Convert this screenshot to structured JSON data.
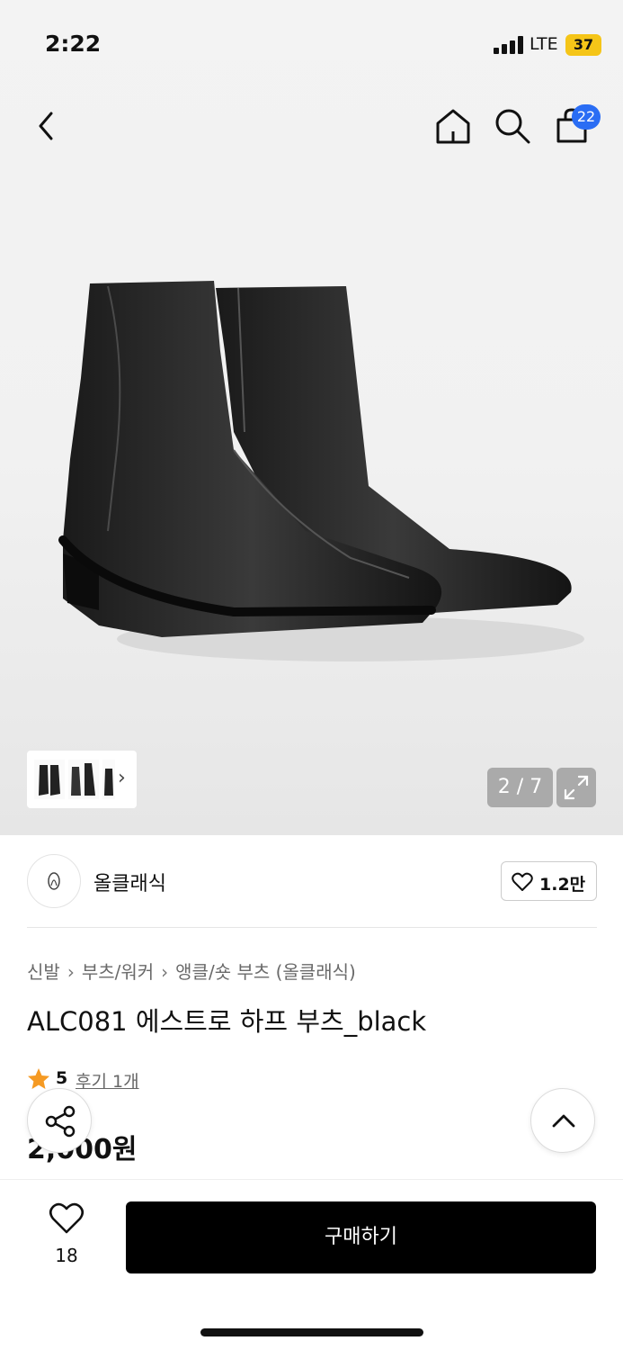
{
  "status_bar": {
    "time": "2:22",
    "network": "LTE",
    "battery": "37"
  },
  "header": {
    "back_icon": "chevron-left-icon",
    "home_icon": "home-icon",
    "search_icon": "search-icon",
    "cart_icon": "shopping-bag-icon",
    "cart_count": "22"
  },
  "gallery": {
    "counter": "2 / 7",
    "expand_icon": "expand-icon",
    "thumbnail_next_icon": "chevron-right-icon"
  },
  "brand": {
    "name": "올클래식",
    "like_count": "1.2만"
  },
  "breadcrumb": [
    "신발",
    "부츠/워커",
    "앵클/숏 부츠 (올클래식)"
  ],
  "product": {
    "title": "ALC081 에스트로 하프 부츠_black",
    "rating": "5",
    "reviews": "후기 1개",
    "price": "2",
    "price_tail": ",000원"
  },
  "actions": {
    "share_icon": "share-icon",
    "scroll_top_icon": "chevron-up-icon",
    "wish_count": "18",
    "buy_label": "구매하기"
  },
  "colors": {
    "badge": "#2a6df4",
    "star": "#f59a23",
    "buy_bg": "#000000"
  }
}
